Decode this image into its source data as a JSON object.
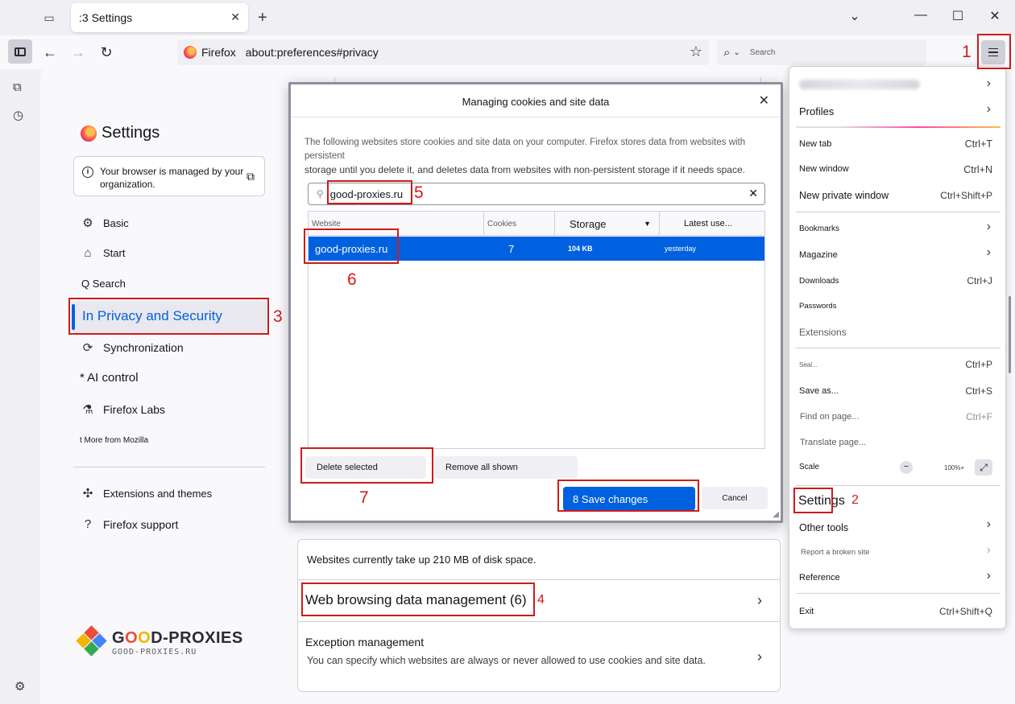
{
  "tab": {
    "title": ":3 Settings"
  },
  "urlbar": {
    "identity": "Firefox",
    "url": "about:preferences#privacy"
  },
  "searchbar": {
    "placeholder": "Search"
  },
  "settings": {
    "title": "Settings",
    "managed_notice": "Your browser is managed by your organization.",
    "nav": [
      {
        "label": "Basic",
        "icon": "gear-icon"
      },
      {
        "label": "Start",
        "icon": "home-icon"
      },
      {
        "label": "Q Search",
        "icon": ""
      },
      {
        "label": "In Privacy and Security",
        "icon": ""
      },
      {
        "label": "Synchronization",
        "icon": "sync-icon"
      },
      {
        "label": "* AI control",
        "icon": ""
      },
      {
        "label": "Firefox Labs",
        "icon": "flask-icon"
      },
      {
        "label": "t More from Mozilla",
        "icon": ""
      },
      {
        "label": "Extensions and themes",
        "icon": "puzzle-icon"
      },
      {
        "label": "Firefox support",
        "icon": "help-icon"
      }
    ]
  },
  "logo": {
    "main_prefix": "G",
    "o1": "O",
    "o2": "O",
    "main_suffix": "D-PROXIES",
    "sub": "GOOD-PROXIES.RU"
  },
  "main": {
    "disk_usage": "Websites currently take up 210 MB of disk space.",
    "web_data": "Web browsing data management (6)",
    "exceptions_title": "Exception management",
    "exceptions_desc": "You can specify which websites are always or never allowed to use cookies and site data."
  },
  "dialog": {
    "title": "Managing cookies and site data",
    "desc_line1": "The following websites store cookies and site data on your computer. Firefox stores data from websites with persistent",
    "desc_line2": "storage until you delete it, and deletes data from websites with non-persistent storage if it needs space.",
    "search_value": "good-proxies.ru",
    "columns": [
      "Website",
      "Cookies",
      "Storage",
      "Latest use..."
    ],
    "rows": [
      {
        "site": "good-proxies.ru",
        "cookies": "7",
        "storage": "104 KB",
        "last_used": "yesterday"
      }
    ],
    "delete_selected": "Delete selected",
    "remove_all": "Remove all shown",
    "save": "8 Save changes",
    "cancel": "Cancel"
  },
  "app_menu": {
    "profiles": "Profiles",
    "new_tab": "New tab",
    "new_tab_sc": "Ctrl+T",
    "new_window": "New window",
    "new_window_sc": "Ctrl+N",
    "new_private": "New private window",
    "new_private_sc": "Ctrl+Shift+P",
    "bookmarks": "Bookmarks",
    "magazine": "Magazine",
    "downloads": "Downloads",
    "downloads_sc": "Ctrl+J",
    "passwords": "Passwords",
    "extensions": "Extensions",
    "print": "Seal...",
    "print_sc": "Ctrl+P",
    "save_as": "Save as...",
    "save_as_sc": "Ctrl+S",
    "find": "Find on page...",
    "find_sc": "Ctrl+F",
    "translate": "Translate page...",
    "scale": "Scale",
    "zoom_minus": "−",
    "zoom_value": "100%+",
    "settings": "Settings",
    "other_tools": "Other tools",
    "report": "Report a broken site",
    "reference": "Reference",
    "exit": "Exit",
    "exit_sc": "Ctrl+Shift+Q"
  },
  "annotations": {
    "n1": "1",
    "n2": "2",
    "n3": "3",
    "n4": "4",
    "n5": "5",
    "n6": "6",
    "n7": "7"
  },
  "colors": {
    "accent": "#0061e0",
    "annotation": "#d01a1a"
  }
}
